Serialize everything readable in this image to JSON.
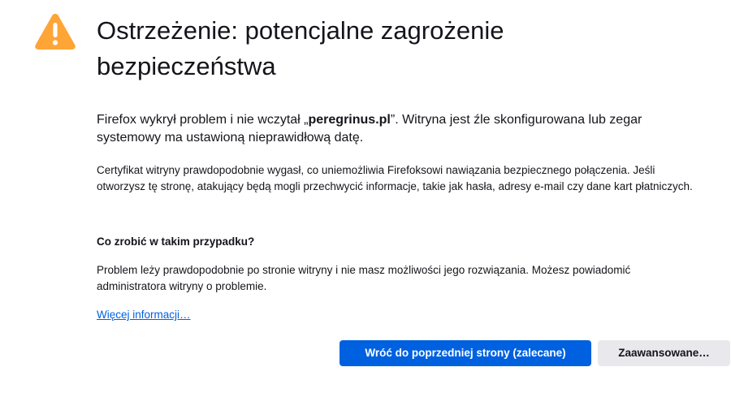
{
  "icon": "warning-triangle-icon",
  "colors": {
    "warning": "#ffa436",
    "primary": "#0061e0",
    "link": "#0061e0",
    "secondary_bg": "#e9e9ed",
    "text": "#15141a"
  },
  "title": "Ostrzeżenie: potencjalne zagrożenie bezpieczeństwa",
  "intro": {
    "before": "Firefox wykrył problem i nie wczytał „",
    "site": "peregrinus.pl",
    "after": "”. Witryna jest źle skonfigurowana lub zegar systemowy ma ustawioną nieprawidłową datę."
  },
  "detail": "Certyfikat witryny prawdopodobnie wygasł, co uniemożliwia Firefoksowi nawiązania bezpiecznego połączenia. Jeśli otworzysz tę stronę, atakujący będą mogli przechwycić informacje, takie jak hasła, adresy e-mail czy dane kart płatniczych.",
  "what_to_do": {
    "heading": "Co zrobić w takim przypadku?",
    "body": "Problem leży prawdopodobnie po stronie witryny i nie masz możliwości jego rozwiązania. Możesz powiadomić administratora witryny o problemie."
  },
  "more_info_link": "Więcej informacji…",
  "buttons": {
    "go_back": "Wróć do poprzedniej strony (zalecane)",
    "advanced": "Zaawansowane…"
  }
}
